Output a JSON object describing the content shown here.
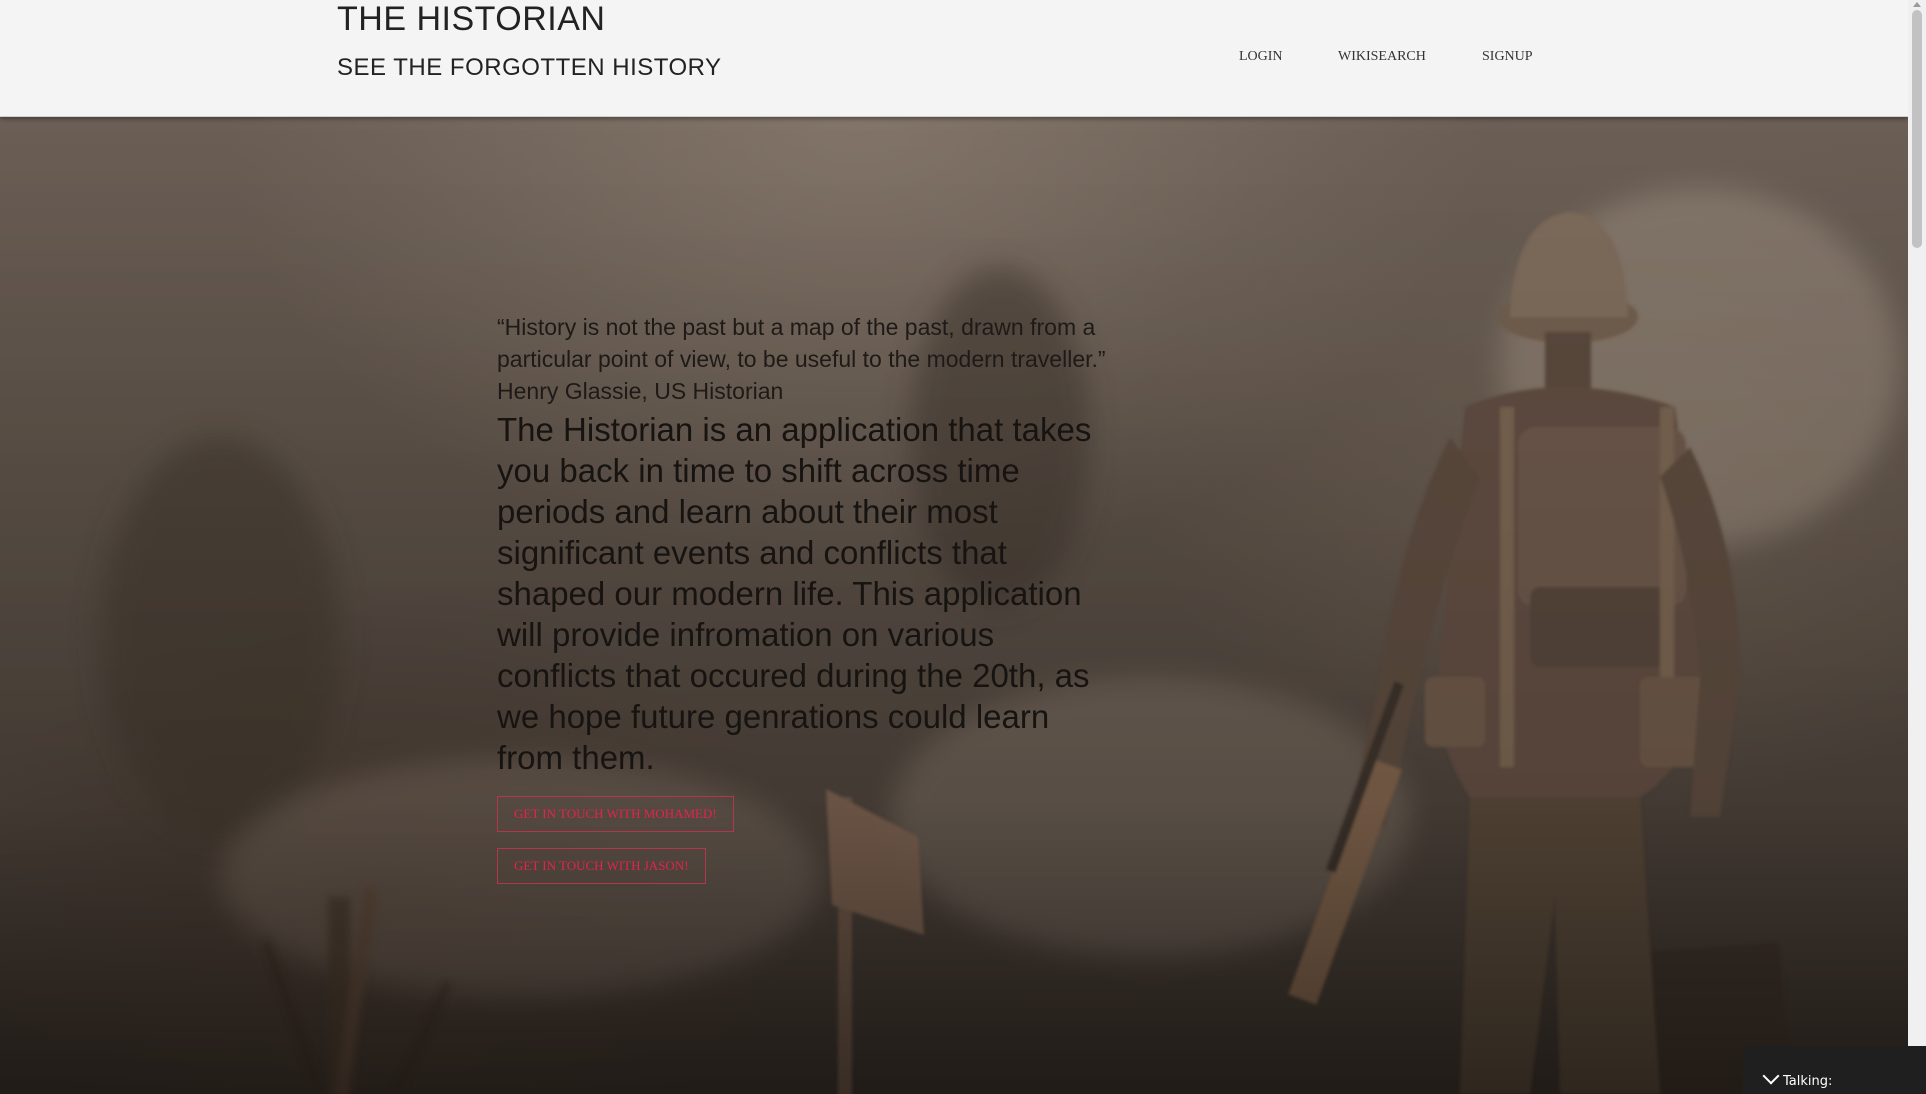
{
  "header": {
    "title": "THE HISTORIAN",
    "subtitle": "SEE THE FORGOTTEN HISTORY",
    "nav": {
      "login": "LOGIN",
      "wikisearch": "WIKISEARCH",
      "signup": "SIGNUP"
    }
  },
  "hero": {
    "quote": "“History is not the past but a map of the past, drawn from a particular point of view, to be useful to the modern traveller.” Henry Glassie, US Historian",
    "description": "The Historian is an application that takes you back in time to shift across time periods and learn about their most significant events and conflicts that shaped our modern life. This application will provide infromation on various conflicts that occured during the 20th, as we hope future genrations could learn from them.",
    "cta_mohamed": "GET IN TOUCH WITH MOHAMED!",
    "cta_jason": "GET IN TOUCH WITH JASON!"
  },
  "widget": {
    "talking_label": "Talking:"
  },
  "colors": {
    "header_bg": "#f4f4f4",
    "cta_text": "#e4224a",
    "cta_border": "#b3364a",
    "widget_bg": "#1f1f1f"
  },
  "icons": {
    "widget_toggle": "chevron-down-icon"
  }
}
